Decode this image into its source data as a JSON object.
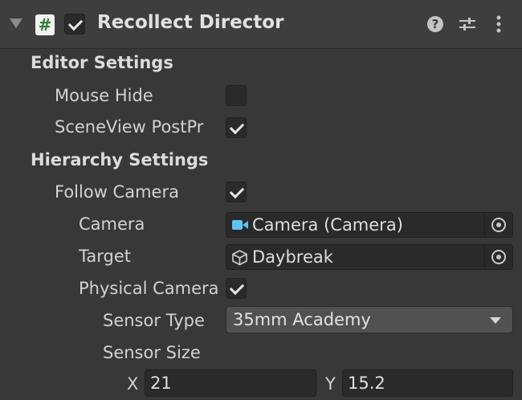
{
  "component": {
    "title": "Recollect Director",
    "script_icon_glyph": "#",
    "enabled": true
  },
  "sections": {
    "editor_settings": "Editor Settings",
    "hierarchy_settings": "Hierarchy Settings"
  },
  "fields": {
    "mouse_hide": {
      "label": "Mouse Hide",
      "checked": false
    },
    "sceneview_postpr": {
      "label": "SceneView PostPr",
      "checked": true
    },
    "follow_camera": {
      "label": "Follow Camera",
      "checked": true
    },
    "camera": {
      "label": "Camera",
      "value": "Camera (Camera)",
      "icon": "camera-icon"
    },
    "target": {
      "label": "Target",
      "value": "Daybreak",
      "icon": "cube-icon"
    },
    "physical_camera": {
      "label": "Physical Camera",
      "checked": true
    },
    "sensor_type": {
      "label": "Sensor Type",
      "value": "35mm Academy"
    },
    "sensor_size": {
      "label": "Sensor Size",
      "x_label": "X",
      "x_value": "21",
      "y_label": "Y",
      "y_value": "15.2"
    }
  },
  "colors": {
    "background": "#383838",
    "header": "#3e3e3e",
    "camera_icon": "#5fc4f0",
    "script_icon_fg": "#2e7d32"
  }
}
